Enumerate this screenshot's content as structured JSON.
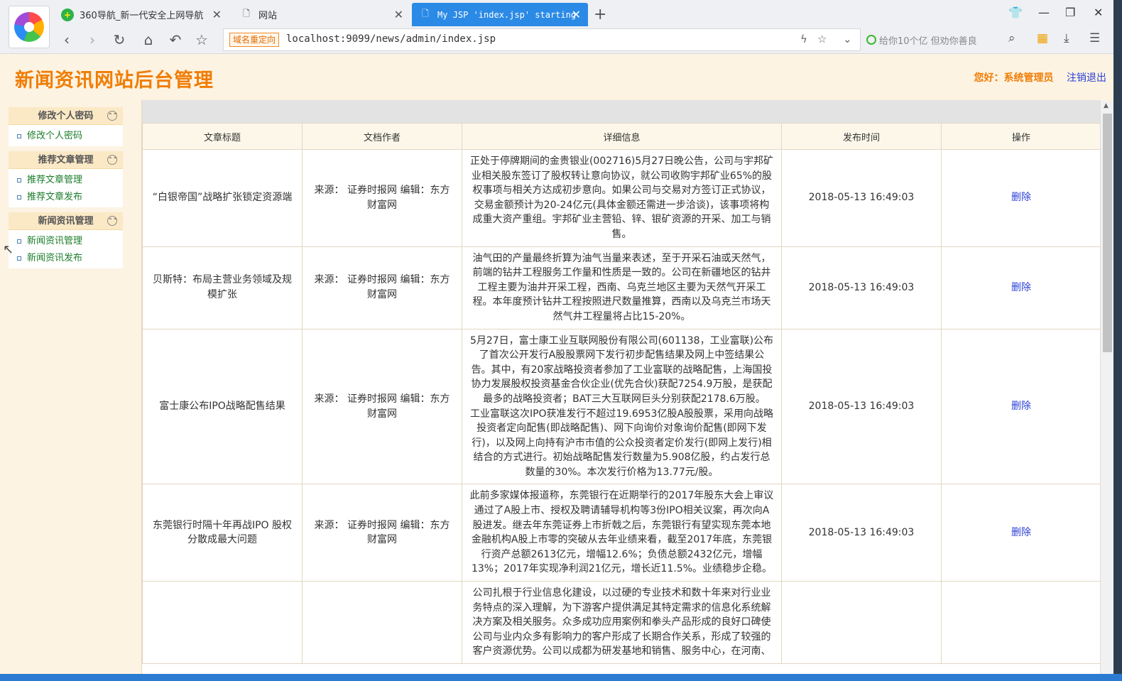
{
  "browser": {
    "tabs": [
      {
        "label": "360导航_新一代安全上网导航",
        "icon": "360-icon"
      },
      {
        "label": "网站",
        "icon": "page-icon"
      },
      {
        "label": "My JSP 'index.jsp' starting",
        "icon": "page-icon"
      }
    ],
    "redirect_badge": "域名重定向",
    "url": "localhost:9099/news/admin/index.jsp",
    "search_text": "给你10个亿 但劝你善良"
  },
  "header": {
    "site_title": "新闻资讯网站后台管理",
    "greeting": "您好：系统管理员",
    "logout": "注销退出"
  },
  "sidebar": {
    "groups": [
      {
        "title": "修改个人密码",
        "items": [
          "修改个人密码"
        ]
      },
      {
        "title": "推荐文章管理",
        "items": [
          "推荐文章管理",
          "推荐文章发布"
        ]
      },
      {
        "title": "新闻资讯管理",
        "items": [
          "新闻资讯管理",
          "新闻资讯发布"
        ]
      }
    ]
  },
  "table": {
    "headers": [
      "文章标题",
      "文档作者",
      "详细信息",
      "发布时间",
      "操作"
    ],
    "rows": [
      {
        "title": "“白银帝国”战略扩张锁定资源端",
        "author": "来源： 证券时报网 编辑：东方财富网",
        "detail": "正处于停牌期间的金贵银业(002716)5月27日晚公告，公司与宇邦矿业相关股东签订了股权转让意向协议，就公司收购宇邦矿业65%的股权事项与相关方达成初步意向。如果公司与交易对方签订正式协议，交易金额预计为20-24亿元(具体金额还需进一步洽谈)，该事项将构成重大资产重组。宇邦矿业主营铅、锌、银矿资源的开采、加工与销售。",
        "time": "2018-05-13 16:49:03",
        "action": "删除"
      },
      {
        "title": "贝斯特：布局主营业务领域及规模扩张",
        "author": "来源： 证券时报网 编辑：东方财富网",
        "detail": "油气田的产量最终折算为油气当量来表述，至于开采石油或天然气，前端的钻井工程服务工作量和性质是一致的。公司在新疆地区的钻井工程主要为油井开采工程，西南、乌克兰地区主要为天然气开采工程。本年度预计钻井工程按照进尺数量推算，西南以及乌克兰市场天然气井工程量将占比15-20%。",
        "time": "2018-05-13 16:49:03",
        "action": "删除"
      },
      {
        "title": "富士康公布IPO战略配售结果",
        "author": "来源： 证券时报网 编辑：东方财富网",
        "detail": "5月27日，富士康工业互联网股份有限公司(601138，工业富联)公布了首次公开发行A股股票网下发行初步配售结果及网上中签结果公告。其中，有20家战略投资者参加了工业富联的战略配售，上海国投协力发展股权投资基金合伙企业(优先合伙)获配7254.9万股，是获配最多的战略投资者；BAT三大互联网巨头分别获配2178.6万股。　　工业富联这次IPO获准发行不超过19.6953亿股A股股票，采用向战略投资者定向配售(即战略配售)、网下向询价对象询价配售(即网下发行)，以及网上向持有沪市市值的公众投资者定价发行(即网上发行)相结合的方式进行。初始战略配售发行数量为5.908亿股，约占发行总数量的30%。本次发行价格为13.77元/股。",
        "time": "2018-05-13 16:49:03",
        "action": "删除"
      },
      {
        "title": "东莞银行时隔十年再战IPO 股权分散成最大问题",
        "author": "来源： 证券时报网 编辑：东方财富网",
        "detail": "此前多家媒体报道称，东莞银行在近期举行的2017年股东大会上审议通过了A股上市、授权及聘请辅导机构等3份IPO相关议案，再次向A股进发。继去年东莞证券上市折戟之后，东莞银行有望实现东莞本地金融机构A股上市零的突破从去年业绩来看，截至2017年底，东莞银行资产总额2613亿元，增幅12.6%；负债总额2432亿元，增幅13%；2017年实现净利润21亿元，增长近11.5%。业绩稳步企稳。",
        "time": "2018-05-13 16:49:03",
        "action": "删除"
      },
      {
        "title": "",
        "author": "",
        "detail": "公司扎根于行业信息化建设，以过硬的专业技术和数十年来对行业业务特点的深入理解，为下游客户提供满足其特定需求的信息化系统解决方案及相关服务。众多成功应用案例和拳头产品形成的良好口碑使公司与业内众多有影响力的客户形成了长期合作关系，形成了较强的客户资源优势。公司以成都为研发基地和销售、服务中心，在河南、",
        "time": "",
        "action": ""
      }
    ]
  }
}
